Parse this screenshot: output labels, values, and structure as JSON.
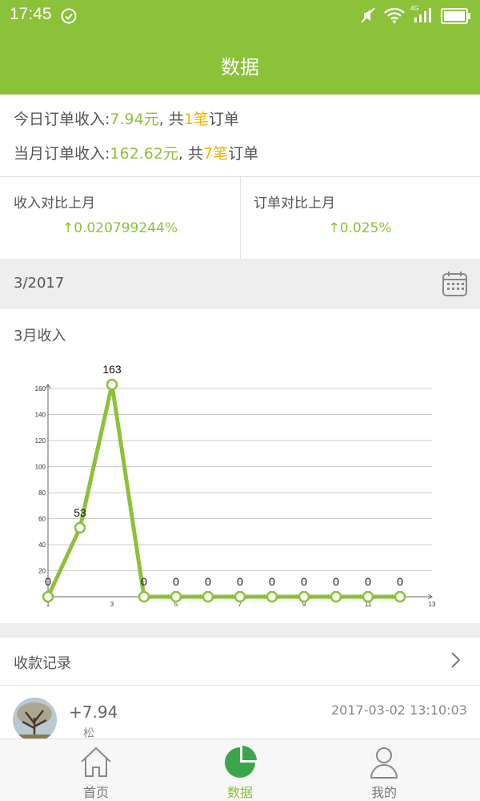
{
  "status_bar": {
    "time": "17:45",
    "network": "4G"
  },
  "header": {
    "title": "数据"
  },
  "summary": {
    "today_prefix": "今日订单收入:",
    "today_amount": "7.94元",
    "today_mid": ", 共",
    "today_count": "1笔",
    "today_suffix": "订单",
    "month_prefix": "当月订单收入:",
    "month_amount": "162.62元",
    "month_mid": ", 共",
    "month_count": "7笔",
    "month_suffix": "订单"
  },
  "compare": {
    "income_label": "收入对比上月",
    "income_value": "↑0.020799244%",
    "order_label": "订单对比上月",
    "order_value": "↑0.025%"
  },
  "date_bar": {
    "date": "3/2017"
  },
  "chart_title": "3月收入",
  "chart_data": {
    "type": "line",
    "title": "",
    "xlabel": "",
    "ylabel": "",
    "x": [
      1,
      2,
      3,
      4,
      5,
      6,
      7,
      8,
      9,
      10,
      11,
      12
    ],
    "values": [
      0,
      53,
      163,
      0,
      0,
      0,
      0,
      0,
      0,
      0,
      0,
      0
    ],
    "data_labels": [
      "0",
      "53",
      "163",
      "0",
      "0",
      "0",
      "0",
      "0",
      "0",
      "0",
      "0",
      "0"
    ],
    "x_ticks": [
      "1",
      "3",
      "5",
      "7",
      "9",
      "11",
      "13"
    ],
    "y_ticks": [
      "20",
      "40",
      "60",
      "80",
      "100",
      "120",
      "140",
      "160"
    ],
    "xlim": [
      1,
      13
    ],
    "ylim": [
      0,
      160
    ],
    "grid": true,
    "color": "#8cc13a"
  },
  "records": {
    "label": "收款记录",
    "items": [
      {
        "amount": "+7.94",
        "name": "松",
        "time": "2017-03-02 13:10:03"
      }
    ]
  },
  "tabs": [
    {
      "label": "首页",
      "icon": "home-icon"
    },
    {
      "label": "数据",
      "icon": "pie-chart-icon"
    },
    {
      "label": "我的",
      "icon": "user-icon"
    }
  ],
  "colors": {
    "accent": "#8cc13a",
    "highlight": "#f0b400"
  }
}
